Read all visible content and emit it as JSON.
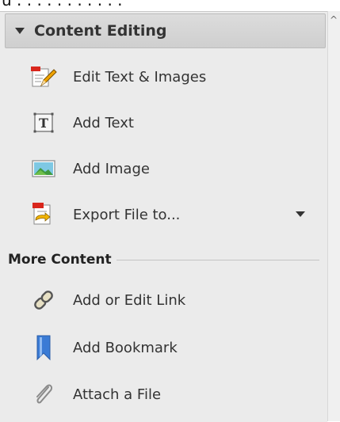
{
  "above_fold_text": "u                    .   .  .  .  .  .      .  .   .  .  . ",
  "panel": {
    "content_editing": {
      "title": "Content Editing",
      "items": [
        {
          "label": "Edit Text & Images",
          "icon": "edit-text-images-icon"
        },
        {
          "label": "Add Text",
          "icon": "add-text-icon"
        },
        {
          "label": "Add Image",
          "icon": "add-image-icon"
        },
        {
          "label": "Export File to...",
          "icon": "export-file-icon"
        }
      ]
    },
    "more_content": {
      "title": "More Content",
      "items": [
        {
          "label": "Add or Edit Link",
          "icon": "link-icon"
        },
        {
          "label": "Add Bookmark",
          "icon": "bookmark-icon"
        },
        {
          "label": "Attach a File",
          "icon": "paperclip-icon"
        }
      ]
    }
  },
  "scrollbar": {
    "up_glyph": "^"
  },
  "colors": {
    "panel_bg": "#ebebeb",
    "header_bg": "#d4d4d4",
    "accent_red": "#d9261c",
    "accent_blue": "#3a7bd5"
  }
}
